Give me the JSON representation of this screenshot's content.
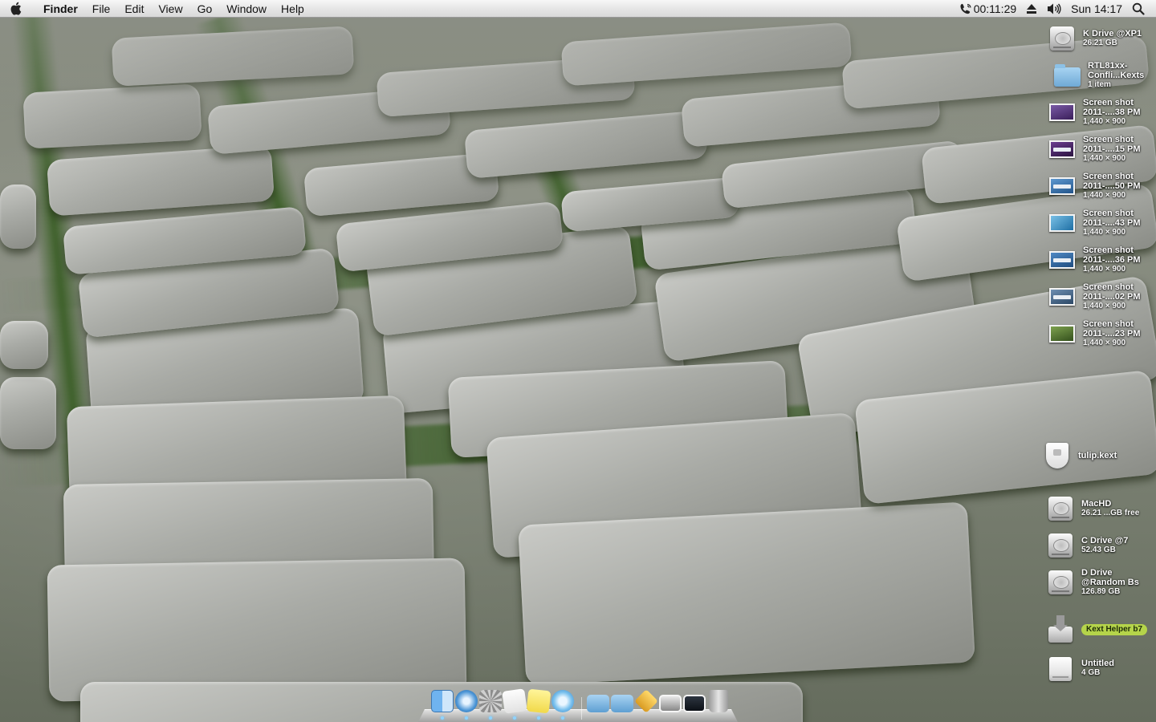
{
  "menubar": {
    "app_name": "Finder",
    "menus": [
      "File",
      "Edit",
      "View",
      "Go",
      "Window",
      "Help"
    ],
    "call_timer": "00:11:29",
    "clock": "Sun 14:17",
    "icons": [
      "apple-icon",
      "phone-icon",
      "eject-icon",
      "volume-icon",
      "spotlight-icon"
    ]
  },
  "desktop_items": [
    {
      "name": "K Drive @XP1",
      "sub": "26.21 GB",
      "kind": "hard-drive"
    },
    {
      "name1": "RTL81xx-",
      "name2": "Confli...Kexts",
      "sub": "1 item",
      "kind": "folder"
    },
    {
      "name1": "Screen shot",
      "name2": "2011-....38 PM",
      "sub": "1,440 × 900",
      "kind": "screenshot",
      "color": "#5b3a82"
    },
    {
      "name1": "Screen shot",
      "name2": "2011-....15 PM",
      "sub": "1,440 × 900",
      "kind": "screenshot",
      "color": "#5a2a78"
    },
    {
      "name1": "Screen shot",
      "name2": "2011-....50 PM",
      "sub": "1,440 × 900",
      "kind": "screenshot",
      "color": "#3d79b8"
    },
    {
      "name1": "Screen shot",
      "name2": "2011-....43 PM",
      "sub": "1,440 × 900",
      "kind": "screenshot",
      "color": "#2e8bc0"
    },
    {
      "name1": "Screen shot",
      "name2": "2011-....36 PM",
      "sub": "1,440 × 900",
      "kind": "screenshot",
      "color": "#2f6fae"
    },
    {
      "name1": "Screen shot",
      "name2": "2011-....02 PM",
      "sub": "1,440 × 900",
      "kind": "screenshot",
      "color": "#4b6f96"
    },
    {
      "name1": "Screen shot",
      "name2": "2011-....23 PM",
      "sub": "1,440 × 900",
      "kind": "screenshot",
      "color": "#5a7d3a"
    },
    {
      "name": "tulip.kext",
      "kind": "kext"
    },
    {
      "name": "MacHD",
      "sub": "26.21 ...GB free",
      "kind": "hard-drive"
    },
    {
      "name": "C Drive @7",
      "sub": "52.43 GB",
      "kind": "hard-drive"
    },
    {
      "name1": "D Drive",
      "name2": "@Random Bs",
      "sub": "126.89 GB",
      "kind": "hard-drive"
    },
    {
      "name": "Kext Helper b7",
      "kind": "installer",
      "highlight": "#b5d44a"
    },
    {
      "name": "Untitled",
      "sub": "4 GB",
      "kind": "usb-drive"
    }
  ],
  "dock": {
    "apps": [
      "finder-icon",
      "safari-icon",
      "system-preferences-icon",
      "textedit-icon",
      "stickies-icon",
      "itunes-icon",
      "applications-folder-icon",
      "documents-folder-icon",
      "stack-icon",
      "preview-icon",
      "screenshot-icon",
      "trash-icon"
    ]
  }
}
